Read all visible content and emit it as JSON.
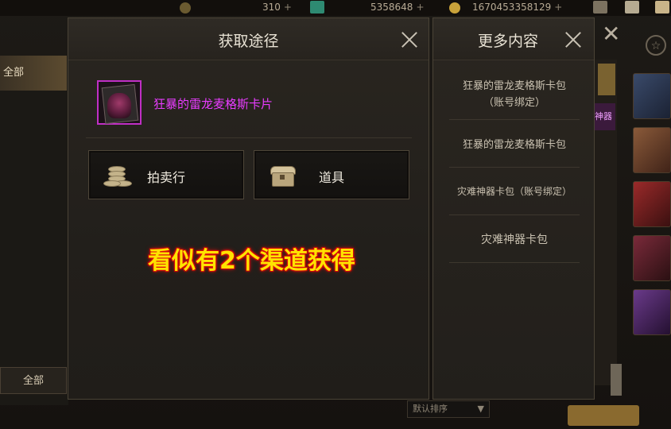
{
  "topbar": {
    "currency1": "310",
    "currency2": "5358648",
    "currency3": "1670453358129",
    "plus": "+"
  },
  "background": {
    "left_tab_top": "全部",
    "left_tab_bottom": "全部",
    "magenta_tag": "神器",
    "dropdown": "默认排序"
  },
  "dialog": {
    "title": "获取途径",
    "item_name": "狂暴的雷龙麦格斯卡片",
    "sources": [
      {
        "label": "拍卖行",
        "icon": "coins-icon"
      },
      {
        "label": "道具",
        "icon": "chest-icon"
      }
    ]
  },
  "caption": "看似有2个渠道获得",
  "more_panel": {
    "title": "更多内容",
    "items": [
      {
        "line1": "狂暴的雷龙麦格斯卡包",
        "line2": "（账号绑定）"
      },
      {
        "line1": "狂暴的雷龙麦格斯卡包",
        "line2": ""
      },
      {
        "line1": "灾难神器卡包（账号绑定）",
        "line2": ""
      },
      {
        "line1": "灾难神器卡包",
        "line2": ""
      }
    ]
  },
  "colors": {
    "item_name": "#e83cff",
    "caption": "#ffe300",
    "caption_outline": "#e01010",
    "rarity_border": "#c02fc5"
  }
}
